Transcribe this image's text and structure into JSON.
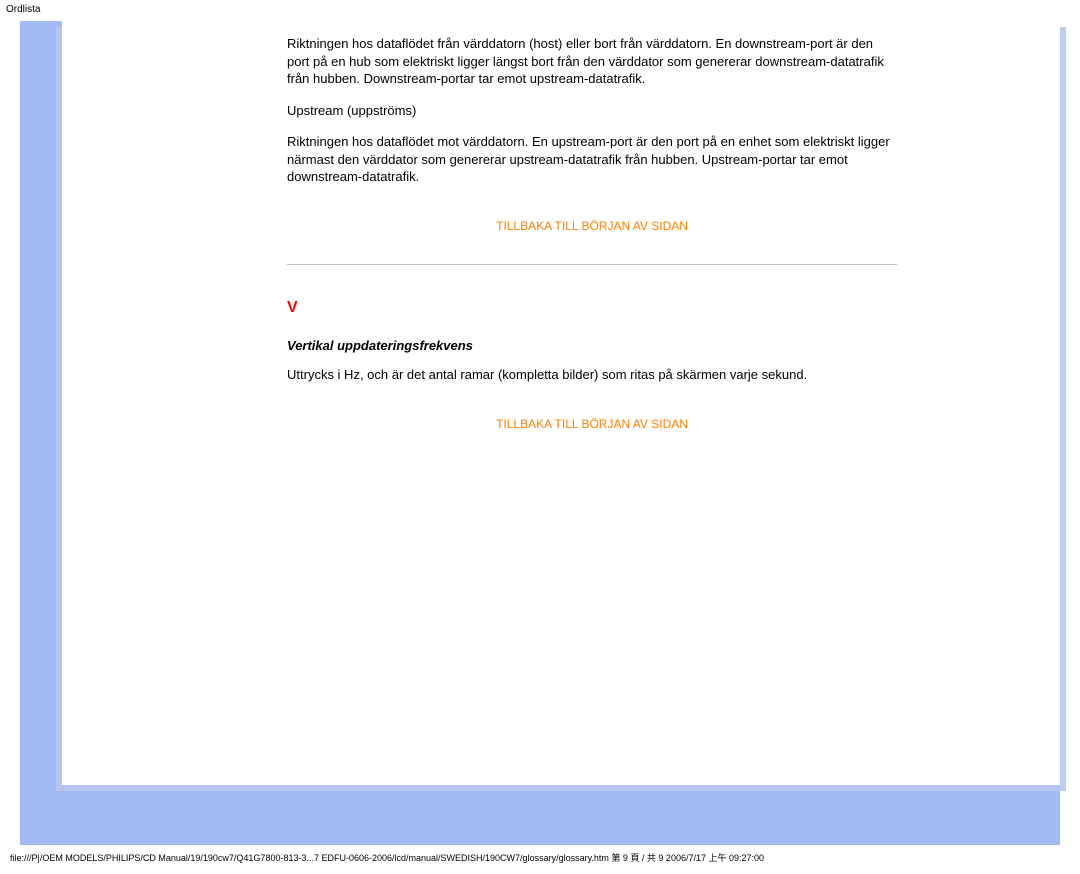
{
  "header": {
    "label": "Ordlista"
  },
  "content": {
    "downstream_para": "Riktningen hos dataflödet från värddatorn (host) eller bort från värddatorn. En downstream-port är den port på en hub som elektriskt ligger längst bort från den värddator som genererar downstream-datatrafik från hubben. Downstream-portar tar emot upstream-datatrafik.",
    "upstream_label": "Upstream (uppströms)",
    "upstream_para": "Riktningen hos dataflödet mot värddatorn. En upstream-port är den port på en enhet som elektriskt ligger närmast den värddator som genererar upstream-datatrafik från hubben. Upstream-portar tar emot downstream-datatrafik.",
    "back_link_1": "TILLBAKA TILL BÖRJAN AV SIDAN",
    "section_letter": "V",
    "term_title": "Vertikal uppdateringsfrekvens",
    "term_def": "Uttrycks i Hz, och är det antal ramar (kompletta bilder) som ritas på skärmen varje sekund.",
    "back_link_2": "TILLBAKA TILL BÖRJAN AV SIDAN"
  },
  "footer": {
    "path": "file:///P|/OEM MODELS/PHILIPS/CD Manual/19/190cw7/Q41G7800-813-3...7 EDFU-0606-2006/lcd/manual/SWEDISH/190CW7/glossary/glossary.htm 第 9 頁 / 共 9 2006/7/17 上午 09:27:00"
  }
}
